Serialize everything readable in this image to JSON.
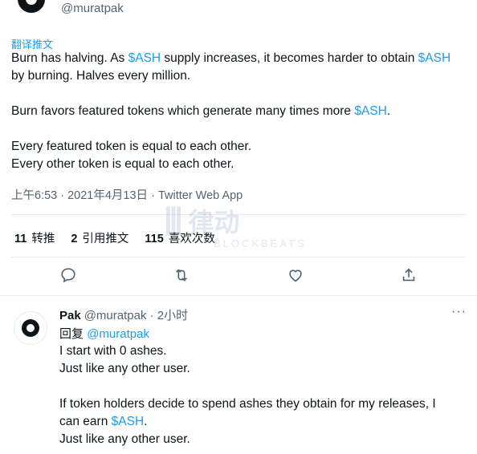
{
  "tweet": {
    "handle": "@muratpak",
    "translate_label": "翻译推文",
    "body": [
      [
        "Burn has halving. As ",
        "$ASH",
        " supply increases, it becomes harder to obtain ",
        "$ASH"
      ],
      "by burning. Halves every million.",
      "",
      [
        "Burn favors featured tokens which generate many times more ",
        "$ASH",
        "."
      ],
      "",
      "Every featured token is equal to each other.",
      "Every other token is equal to each other."
    ],
    "line1": {
      "a": "Burn has halving. As ",
      "b": "$ASH",
      "c": " supply increases, it becomes harder to obtain ",
      "d": "$ASH"
    },
    "line2": "by burning. Halves every million.",
    "line3": {
      "a": "Burn favors featured tokens which generate many times more ",
      "b": "$ASH",
      "c": "."
    },
    "line4": "Every featured token is equal to each other.",
    "line5": "Every other token is equal to each other.",
    "meta": "上午6:53 · 2021年4月13日 · Twitter Web App"
  },
  "stats": {
    "retweets": {
      "count": "11",
      "label": "转推"
    },
    "quotes": {
      "count": "2",
      "label": "引用推文"
    },
    "likes": {
      "count": "115",
      "label": "喜欢次数"
    }
  },
  "actions": {
    "icons": [
      "reply-icon",
      "retweet-icon",
      "like-icon",
      "share-icon"
    ]
  },
  "reply": {
    "name": "Pak",
    "handle": "@muratpak",
    "time": "· 2小时",
    "more": "···",
    "reply_to_label": "回复",
    "reply_to_handle": "@muratpak",
    "line1": "I start with 0 ashes.",
    "line2": "Just like any other user.",
    "line3": "If token holders decide to spend ashes they obtain for my releases, I",
    "line4a": "can earn ",
    "line4b": "$ASH",
    "line4c": ".",
    "line5": "Just like any other user."
  },
  "watermark": {
    "text": "律动",
    "sub": "BLOCKBEATS"
  },
  "colors": {
    "link": "#1d9bf0",
    "muted": "#536471",
    "text": "#0f1419",
    "divider": "#e6ecf0"
  }
}
